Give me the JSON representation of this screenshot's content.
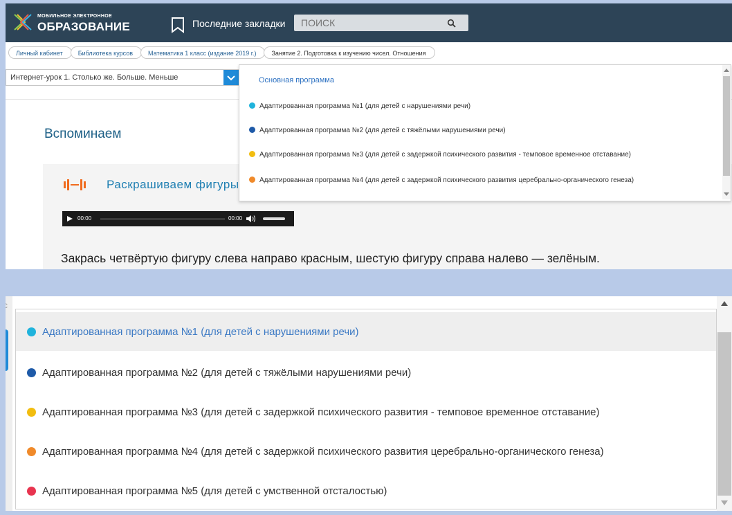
{
  "header": {
    "logo_line1": "МОБИЛЬНОЕ ЭЛЕКТРОННОЕ",
    "logo_line2": "ОБРАЗОВАНИЕ",
    "bookmarks_label": "Последние закладки",
    "search_placeholder": "ПОИСК",
    "bg_color": "#2d4457"
  },
  "breadcrumbs": [
    "Личный кабинет",
    "Библиотека курсов",
    "Математика 1 класс (издание 2019 г.)",
    "Занятие 2. Подготовка к изучению чисел. Отношения"
  ],
  "lesson_select": {
    "value": "Интернет-урок 1. Столько же. Больше. Меньше"
  },
  "program_dropdown": {
    "header": "Основная программа",
    "items": [
      {
        "label": "Адаптированная программа №1 (для детей с нарушениями речи)",
        "color": "#1fb3dc"
      },
      {
        "label": "Адаптированная программа №2 (для детей с тяжёлыми нарушениями речи)",
        "color": "#1e5aa8"
      },
      {
        "label": "Адаптированная программа №3 (для детей с задержкой психического развития - темповое временное отставание)",
        "color": "#f2bd10"
      },
      {
        "label": "Адаптированная программа №4 (для детей с задержкой психического развития церебрально-органического генеза)",
        "color": "#f08a2a"
      }
    ]
  },
  "main": {
    "section_title": "Вспоминаем",
    "task_title": "Раскрашиваем фигуры",
    "audio": {
      "current_time": "00:00",
      "duration": "00:00"
    },
    "instruction": "Закрась четвёртую фигуру слева направо красным, шестую фигуру справа налево — зелёным."
  },
  "zoomed_list": {
    "edge_text": "с",
    "items": [
      {
        "label": "Адаптированная программа №1 (для детей с нарушениями речи)",
        "color": "#1fb3dc",
        "selected": true
      },
      {
        "label": "Адаптированная программа №2 (для детей с тяжёлыми нарушениями речи)",
        "color": "#1e5aa8",
        "selected": false
      },
      {
        "label": "Адаптированная программа №3 (для детей с задержкой психического развития - темповое временное отставание)",
        "color": "#f2bd10",
        "selected": false
      },
      {
        "label": "Адаптированная программа №4 (для детей с задержкой психического развития церебрально-органического генеза)",
        "color": "#f08a2a",
        "selected": false
      },
      {
        "label": "Адаптированная программа №5 (для детей с умственной отсталостью)",
        "color": "#e8344f",
        "selected": false
      }
    ]
  }
}
